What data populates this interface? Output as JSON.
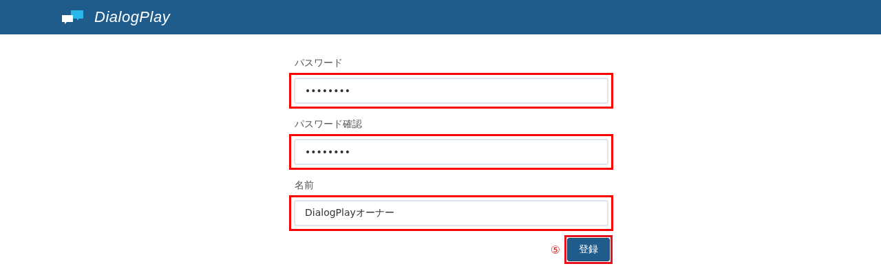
{
  "header": {
    "title": "DialogPlay"
  },
  "fields": [
    {
      "label": "パスワード",
      "value": "••••••••",
      "highlighted": true
    },
    {
      "label": "パスワード確認",
      "value": "••••••••",
      "highlighted": true
    },
    {
      "label": "名前",
      "value": "DialogPlayオーナー",
      "highlighted": true
    }
  ],
  "submit": {
    "step_marker": "⑤",
    "label": "登録",
    "highlighted": true
  }
}
